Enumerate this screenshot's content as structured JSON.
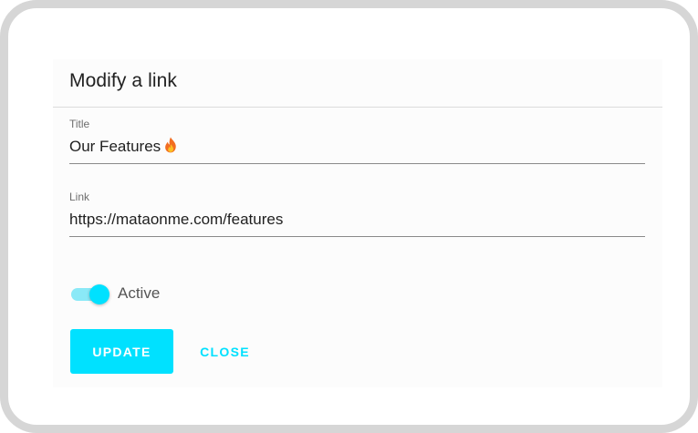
{
  "dialog": {
    "title": "Modify a link"
  },
  "fields": {
    "title": {
      "label": "Title",
      "value": "Our Features",
      "emoji_icon": "fire-icon"
    },
    "link": {
      "label": "Link",
      "value": "https://mataonme.com/features"
    }
  },
  "toggle": {
    "label": "Active",
    "checked": true
  },
  "actions": {
    "update_label": "UPDATE",
    "close_label": "CLOSE"
  },
  "colors": {
    "accent": "#00e1ff",
    "accent_light": "#8ae9f7",
    "frame_border": "#d6d6d6",
    "text_primary": "#212121",
    "text_secondary": "#6e6e6e"
  }
}
